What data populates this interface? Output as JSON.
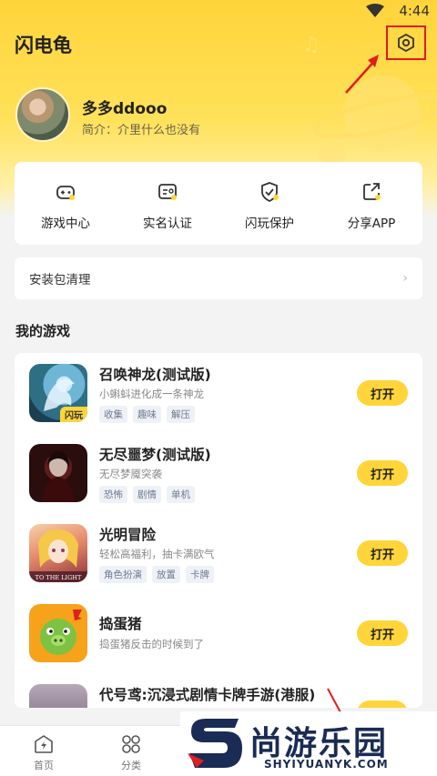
{
  "status_bar": {
    "time": "4:44",
    "wifi_icon": "wifi-icon"
  },
  "header": {
    "title": "闪电龟",
    "settings_icon": "settings-hexagon-icon"
  },
  "profile": {
    "username": "多多ddooo",
    "bio": "简介：介里什么也没有"
  },
  "quick_actions": [
    {
      "label": "游戏中心",
      "icon": "gamepad-icon"
    },
    {
      "label": "实名认证",
      "icon": "id-card-icon"
    },
    {
      "label": "闪玩保护",
      "icon": "shield-check-icon"
    },
    {
      "label": "分享APP",
      "icon": "share-icon"
    }
  ],
  "cleanup": {
    "label": "安装包清理",
    "chevron": "›"
  },
  "my_games": {
    "title": "我的游戏",
    "games": [
      {
        "name": "召唤神龙(测试版)",
        "desc": "小蝌蚪进化成一条神龙",
        "tags": [
          "收集",
          "趣味",
          "解压"
        ],
        "button": "打开",
        "badge": "闪玩"
      },
      {
        "name": "无尽噩梦(测试版)",
        "desc": "无尽梦魇突袭",
        "tags": [
          "恐怖",
          "剧情",
          "单机"
        ],
        "button": "打开"
      },
      {
        "name": "光明冒险",
        "desc": "轻松高福利，抽卡满欧气",
        "tags": [
          "角色扮演",
          "放置",
          "卡牌"
        ],
        "button": "打开",
        "icon_caption": "TO THE LIGHT"
      },
      {
        "name": "捣蛋猪",
        "desc": "捣蛋猪反击的时候到了",
        "tags": [],
        "button": "打开"
      },
      {
        "name": "代号鸢:沉浸式剧情卡牌手游(港服)",
        "desc": "",
        "tags": [],
        "button": "打开"
      }
    ]
  },
  "bottom_nav": [
    {
      "label": "首页",
      "icon": "home-lightning-icon"
    },
    {
      "label": "分类",
      "icon": "category-grid-icon"
    }
  ],
  "watermark": {
    "text": "尚游乐园",
    "url": "SHYIYUANYK.COM"
  },
  "colors": {
    "accent": "#ffd53a",
    "annotation": "#e01b1b",
    "watermark": "#1a2c55"
  }
}
